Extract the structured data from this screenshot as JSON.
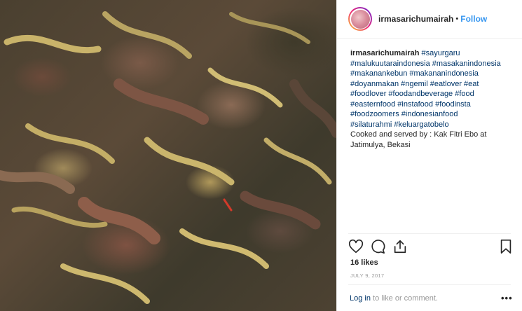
{
  "post": {
    "image_alt": "sayur garu dish photo"
  },
  "header": {
    "username": "irmasarichumairah",
    "separator": "•",
    "follow_label": "Follow"
  },
  "caption": {
    "username": "irmasarichumairah",
    "lines": [
      "#sayurgaru",
      "#malukuutaraindonesia #masakanindonesia",
      "#makanankebun #makananindonesia",
      "#doyanmakan #ngemil #eatlover #eat",
      "#foodlover #foodandbeverage #food",
      "#easternfood #instafood #foodinsta",
      "#foodzoomers #indonesianfood",
      "#silaturahmi #keluargatobelo",
      "Cooked and served by : Kak Fitri Ebo at",
      "Jatimulya, Bekasi"
    ]
  },
  "actions": {
    "like_icon": "heart-icon",
    "comment_icon": "comment-icon",
    "share_icon": "share-icon",
    "save_icon": "bookmark-icon"
  },
  "likes": "16 likes",
  "date": "JULY 9, 2017",
  "comment": {
    "login_label": "Log in",
    "suffix": " to like or comment.",
    "more_label": "•••"
  },
  "colors": {
    "link_blue": "#3897f0",
    "hashtag": "#003569",
    "muted": "#999999",
    "text": "#262626"
  }
}
